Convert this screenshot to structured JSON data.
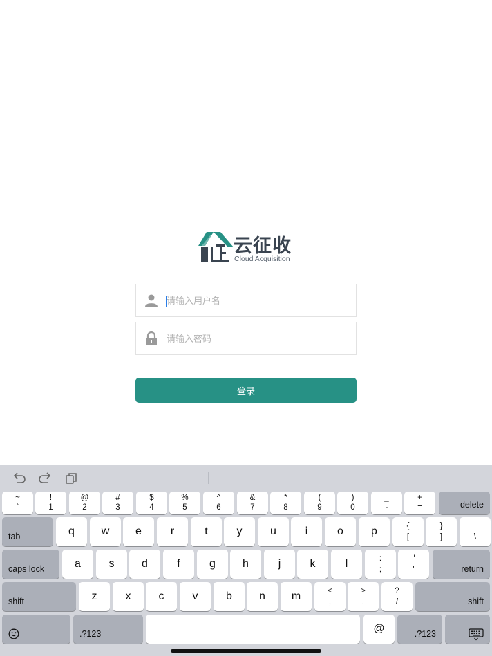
{
  "app": {
    "logo_cn": "云征收",
    "logo_en": "Cloud Acquisition",
    "brand_color": "#279185",
    "logo_dark_color": "#3a4450"
  },
  "login": {
    "username_placeholder": "请输入用户名",
    "password_placeholder": "请输入密码",
    "submit_label": "登录",
    "username_icon": "user-icon",
    "password_icon": "lock-icon"
  },
  "keyboard": {
    "toolbar": {
      "undo_icon": "undo-icon",
      "redo_icon": "redo-icon",
      "paste_icon": "paste-icon"
    },
    "number_row": [
      {
        "top": "~",
        "bottom": "`"
      },
      {
        "top": "!",
        "bottom": "1"
      },
      {
        "top": "@",
        "bottom": "2"
      },
      {
        "top": "#",
        "bottom": "3"
      },
      {
        "top": "$",
        "bottom": "4"
      },
      {
        "top": "%",
        "bottom": "5"
      },
      {
        "top": "^",
        "bottom": "6"
      },
      {
        "top": "&",
        "bottom": "7"
      },
      {
        "top": "*",
        "bottom": "8"
      },
      {
        "top": "(",
        "bottom": "9"
      },
      {
        "top": ")",
        "bottom": "0"
      },
      {
        "top": "_",
        "bottom": "-"
      },
      {
        "top": "+",
        "bottom": "="
      }
    ],
    "delete_label": "delete",
    "tab_label": "tab",
    "row_q": [
      "q",
      "w",
      "e",
      "r",
      "t",
      "y",
      "u",
      "i",
      "o",
      "p"
    ],
    "row_q_symbols": [
      {
        "top": "{",
        "bottom": "["
      },
      {
        "top": "}",
        "bottom": "]"
      },
      {
        "top": "|",
        "bottom": "\\"
      }
    ],
    "caps_label": "caps lock",
    "row_a": [
      "a",
      "s",
      "d",
      "f",
      "g",
      "h",
      "j",
      "k",
      "l"
    ],
    "row_a_symbols": [
      {
        "top": ":",
        "bottom": ";"
      },
      {
        "top": "\"",
        "bottom": "'"
      }
    ],
    "return_label": "return",
    "shift_label": "shift",
    "row_z": [
      "z",
      "x",
      "c",
      "v",
      "b",
      "n",
      "m"
    ],
    "row_z_symbols": [
      {
        "top": "<",
        "bottom": ","
      },
      {
        "top": ">",
        "bottom": "."
      },
      {
        "top": "?",
        "bottom": "/"
      }
    ],
    "numbers_label": ".?123",
    "at_label": "@",
    "emoji_icon": "emoji-icon",
    "dismiss_icon": "keyboard-dismiss-icon"
  }
}
